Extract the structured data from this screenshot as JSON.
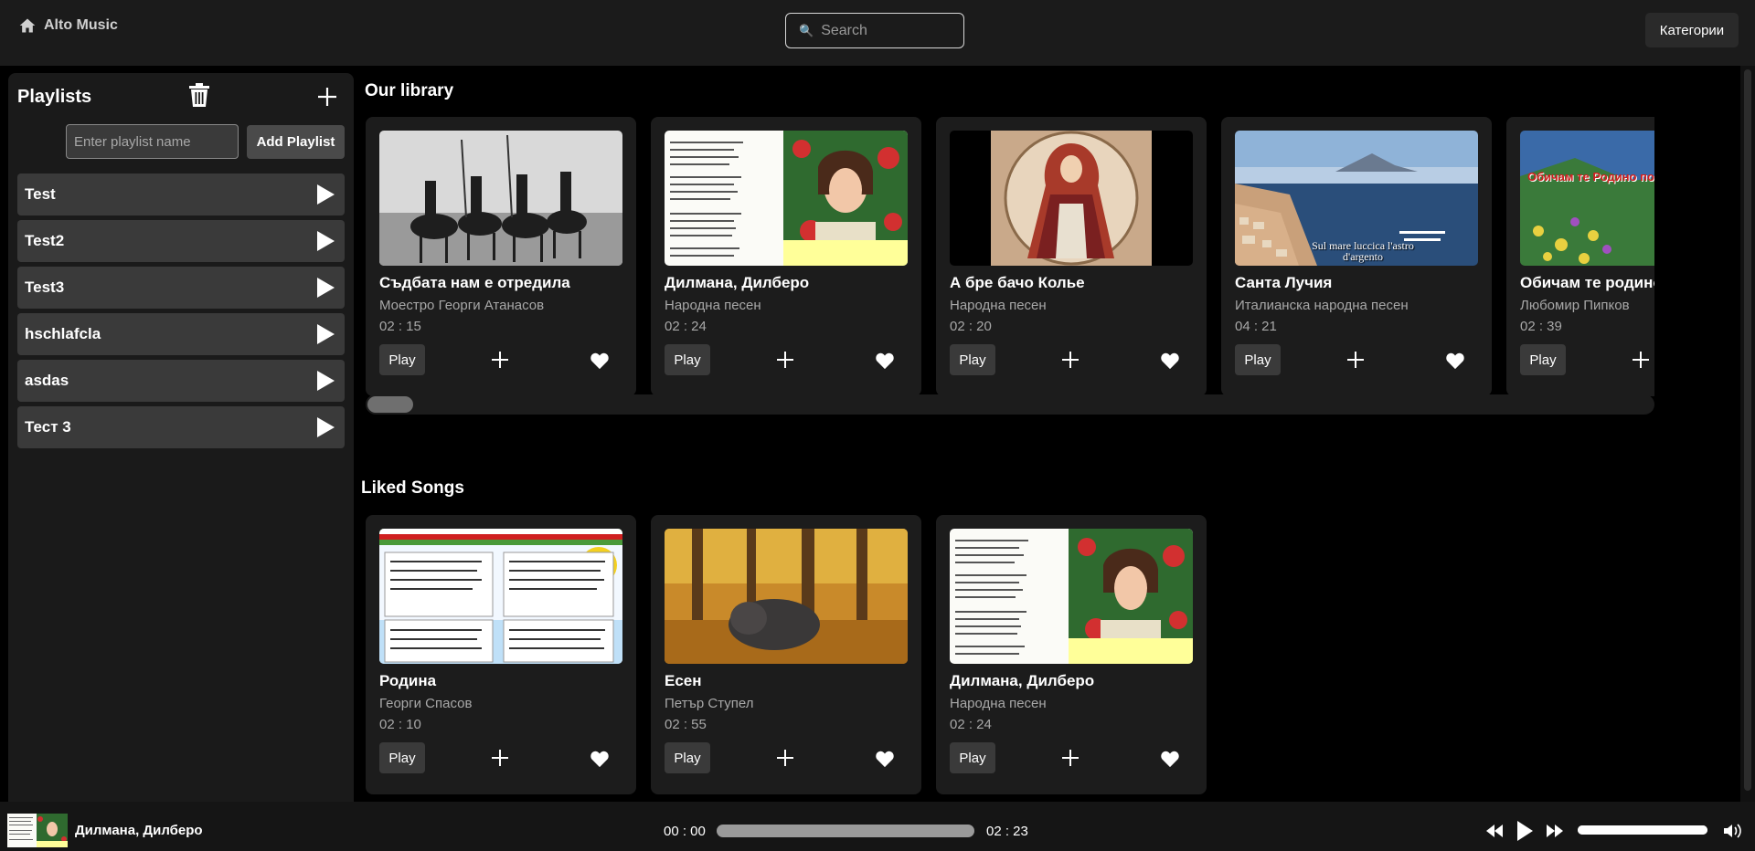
{
  "app": {
    "title": "Alto Music",
    "brand_icon": "home-icon"
  },
  "header": {
    "search_placeholder": "Search",
    "categories_label": "Категории"
  },
  "sidebar": {
    "title": "Playlists",
    "input_placeholder": "Enter playlist name",
    "add_label": "Add Playlist",
    "playlists": [
      {
        "name": "Test"
      },
      {
        "name": "Test2"
      },
      {
        "name": "Test3"
      },
      {
        "name": "hschlafcla"
      },
      {
        "name": "asdas"
      },
      {
        "name": "Тест 3"
      }
    ]
  },
  "library": {
    "title": "Our library",
    "songs": [
      {
        "title": "Съдбата нам е отредила",
        "artist": "Моестро Георги Атанасов",
        "duration": "02 : 15",
        "play_label": "Play",
        "thumb_caption": ""
      },
      {
        "title": "Дилмана, Дилберо",
        "artist": "Народна песен",
        "duration": "02 : 24",
        "play_label": "Play",
        "thumb_caption": ""
      },
      {
        "title": "А бре бачо Колье",
        "artist": "Народна песен",
        "duration": "02 : 20",
        "play_label": "Play",
        "thumb_caption": ""
      },
      {
        "title": "Санта Лучия",
        "artist": "Италианска народна песен",
        "duration": "04 : 21",
        "play_label": "Play",
        "thumb_caption": "Sul mare luccica l'astro d'argento"
      },
      {
        "title": "Обичам те родино",
        "artist": "Любомир Пипков",
        "duration": "02 : 39",
        "play_label": "Play",
        "thumb_caption": "Обичам те Родино под накит"
      }
    ]
  },
  "liked": {
    "title": "Liked Songs",
    "songs": [
      {
        "title": "Родина",
        "artist": "Георги Спасов",
        "duration": "02 : 10",
        "play_label": "Play"
      },
      {
        "title": "Есен",
        "artist": "Петър Ступел",
        "duration": "02 : 55",
        "play_label": "Play"
      },
      {
        "title": "Дилмана, Дилберо",
        "artist": "Народна песен",
        "duration": "02 : 24",
        "play_label": "Play"
      }
    ]
  },
  "player": {
    "title": "Дилмана, Дилберо",
    "current_time": "00 : 00",
    "total_time": "02 : 23",
    "progress": 0,
    "volume": 1.0
  }
}
